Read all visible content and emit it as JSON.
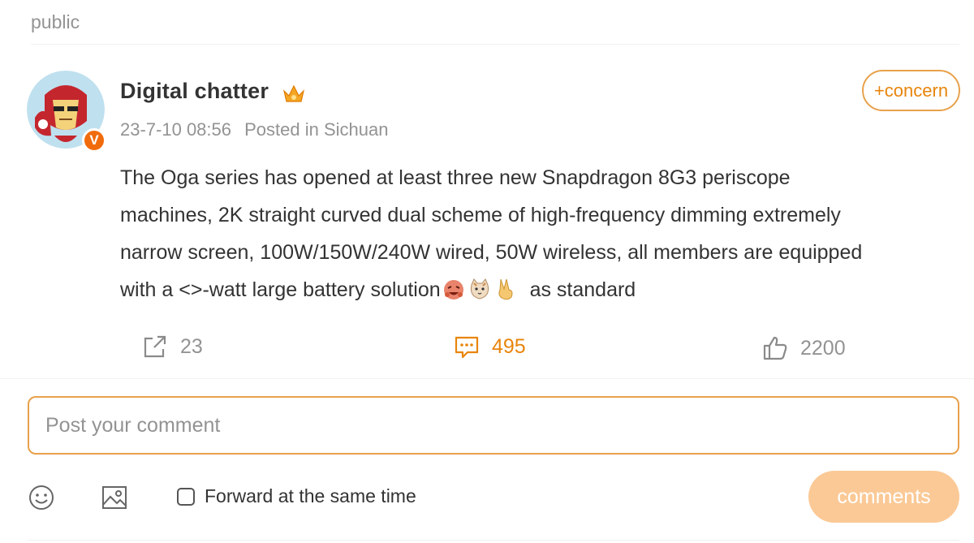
{
  "header": {
    "privacy_label": "public"
  },
  "post": {
    "author": "Digital chatter",
    "verified_badge": "V",
    "timestamp": "23-7-10 08:56",
    "location": "Posted in Sichuan",
    "follow_label": "+concern",
    "text_lines": [
      "The Oga series has opened at least three new Snapdragon 8G3 periscope",
      "machines, 2K straight curved dual scheme of high-frequency dimming extremely",
      "narrow screen, 100W/150W/240W wired, 50W wireless, all members are equipped",
      "with a <>-watt large battery solution"
    ],
    "text_tail": "as standard",
    "emojis": [
      "laughing-emoji",
      "cat-emoji",
      "victory-hand-emoji"
    ]
  },
  "actions": {
    "repost_count": "23",
    "comment_count": "495",
    "like_count": "2200"
  },
  "composer": {
    "placeholder": "Post your comment",
    "forward_label": "Forward at the same time",
    "submit_label": "comments"
  },
  "colors": {
    "accent": "#e8850c",
    "border_accent": "#e8a14b",
    "muted_text": "#939393",
    "submit_disabled": "#fbc996"
  }
}
